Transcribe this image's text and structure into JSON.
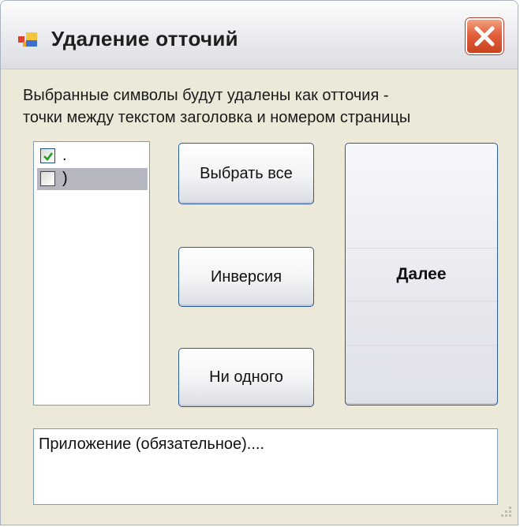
{
  "window": {
    "title": "Удаление отточий"
  },
  "description": {
    "line1": "Выбранные символы будут удалены как отточия -",
    "line2": "точки между текстом заголовка и номером страницы"
  },
  "symbols_list": {
    "items": [
      {
        "label": ".",
        "checked": true,
        "selected": false
      },
      {
        "label": ")",
        "checked": false,
        "selected": true
      }
    ]
  },
  "buttons": {
    "select_all": "Выбрать все",
    "inverse": "Инверсия",
    "none": "Ни одного",
    "next": "Далее"
  },
  "appendix_field": {
    "value": "Приложение (обязательное)...."
  },
  "colors": {
    "button_border": "#2a5aa0",
    "close_button": "#e2603c",
    "check_mark": "#21a121"
  }
}
